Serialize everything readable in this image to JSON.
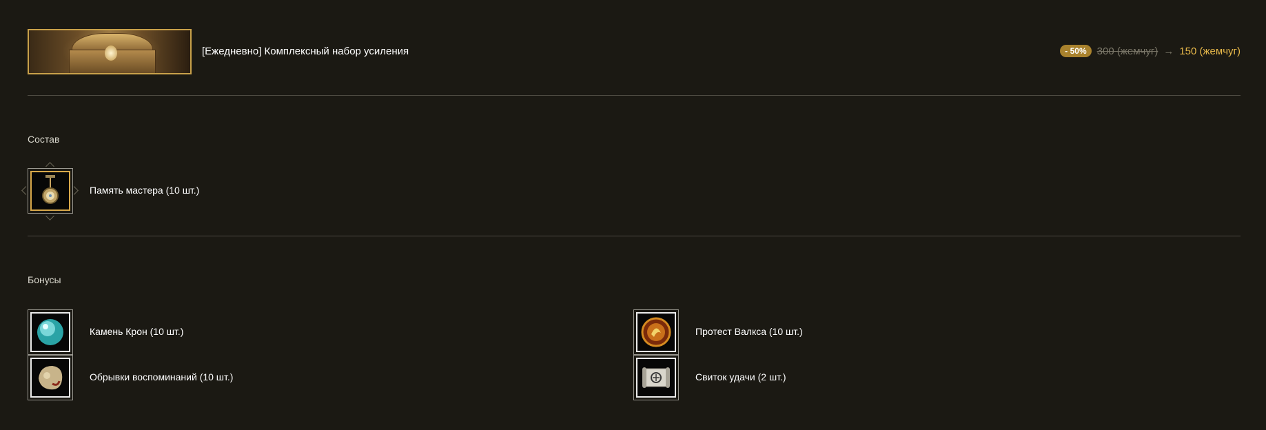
{
  "header": {
    "title": "[Ежедневно] Комплексный набор усиления",
    "discount_badge": "- 50%",
    "old_price": "300 (жемчуг)",
    "arrow": "→",
    "new_price": "150 (жемчуг)"
  },
  "composition": {
    "label": "Состав",
    "items": [
      {
        "label": "Память мастера (10 шт.)",
        "icon": "master-memory-icon"
      }
    ]
  },
  "bonuses": {
    "label": "Бонусы",
    "items": [
      {
        "label": "Камень Крон (10 шт.)",
        "icon": "cron-stone-icon"
      },
      {
        "label": "Протест Валкса (10 шт.)",
        "icon": "valks-protest-icon"
      },
      {
        "label": "Обрывки воспоминаний (10 шт.)",
        "icon": "memory-fragment-icon"
      },
      {
        "label": "Свиток удачи (2 шт.)",
        "icon": "luck-scroll-icon"
      }
    ]
  },
  "colors": {
    "background": "#1b1913",
    "accent_gold": "#c9a14a",
    "new_price": "#e7b84a",
    "badge": "#a9822d",
    "divider": "#4e4b42"
  }
}
